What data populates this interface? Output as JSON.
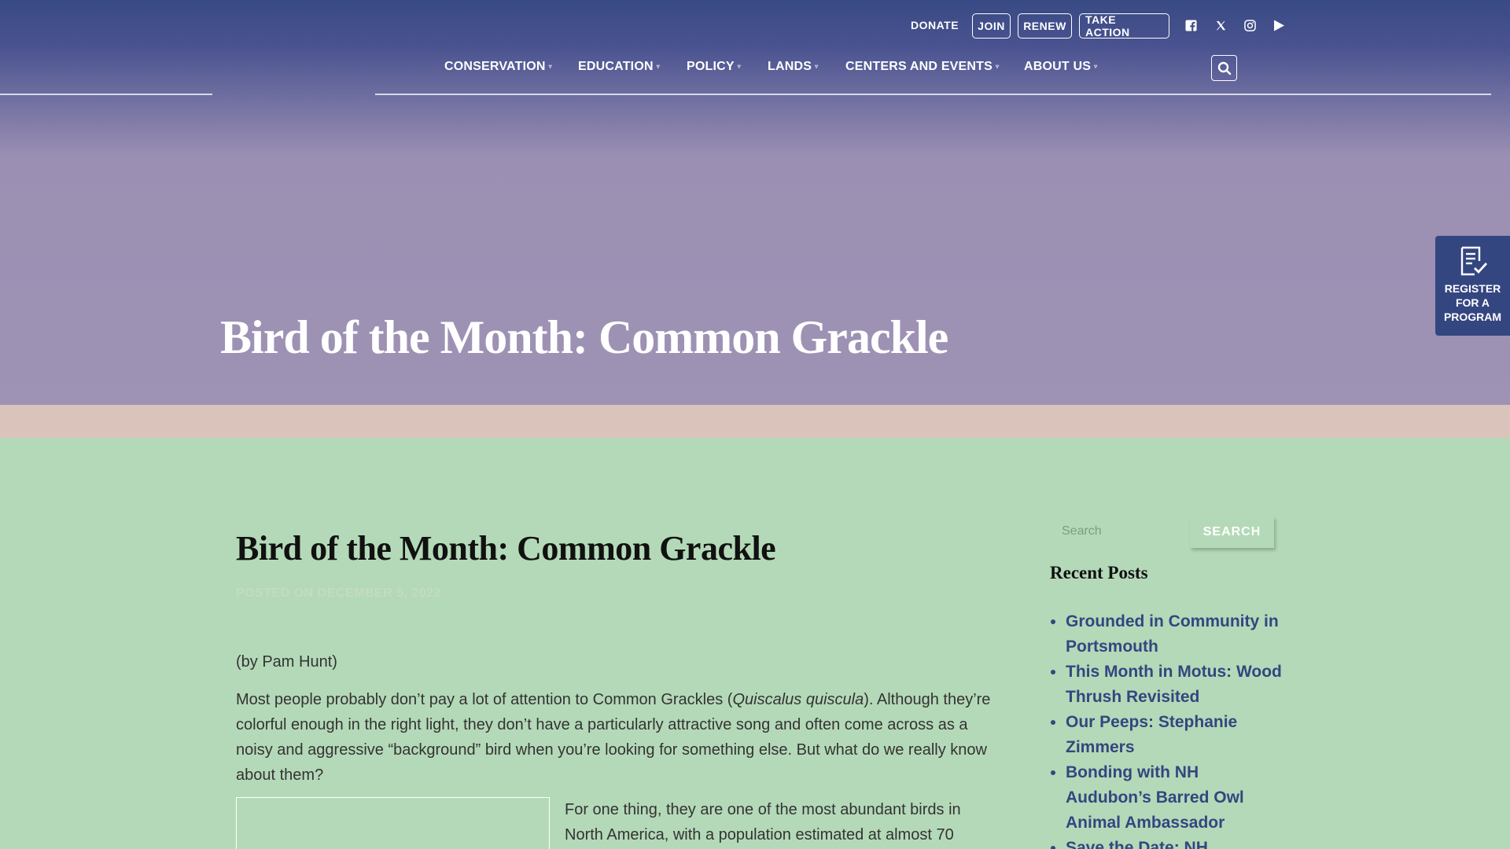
{
  "utility": {
    "donate": "DONATE",
    "join": "JOIN",
    "renew": "RENEW",
    "take_action": "TAKE ACTION",
    "social_icons": [
      "facebook-icon",
      "x-icon",
      "instagram-icon",
      "youtube-icon"
    ]
  },
  "nav": {
    "items": [
      {
        "label": "CONSERVATION"
      },
      {
        "label": "EDUCATION"
      },
      {
        "label": "POLICY"
      },
      {
        "label": "LANDS"
      },
      {
        "label": "CENTERS AND EVENTS"
      },
      {
        "label": "ABOUT US"
      }
    ]
  },
  "hero": {
    "title": "Bird of the Month: Common Grackle"
  },
  "register_tab": {
    "label": "REGISTER FOR A PROGRAM"
  },
  "article": {
    "title": "Bird of the Month: Common Grackle",
    "meta": "POSTED ON DECEMBER 5, 2022",
    "byline": "(by Pam Hunt)",
    "para1_a": "Most people probably don’t pay a lot of attention to Common Grackles (",
    "para1_sci": "Quiscalus quiscula",
    "para1_b": "). Although they’re colorful enough in the right light, they don’t have a particularly attractive song and often come across as a noisy and aggressive “background” bird when you’re looking for something else. But what do we really know about them?",
    "para2": "For one thing, they are one of the most abundant birds in North America, with a population estimated at almost 70"
  },
  "sidebar": {
    "search_placeholder": "Search",
    "search_button": "SEARCH",
    "recent_heading": "Recent Posts",
    "recent_posts": [
      "Grounded in Community in Portsmouth",
      "This Month in Motus: Wood Thrush Revisited",
      "Our Peeps: Stephanie Zimmers",
      "Bonding with NH Audubon’s Barred Owl Animal Ambassador",
      "Save the Date: NH Audubon"
    ]
  },
  "colors": {
    "nav_bg": "#384a84",
    "hero_bg": "#9e93b4",
    "band": "#d9c3bb",
    "page_bg": "#b4d9b8",
    "link": "#344680"
  }
}
